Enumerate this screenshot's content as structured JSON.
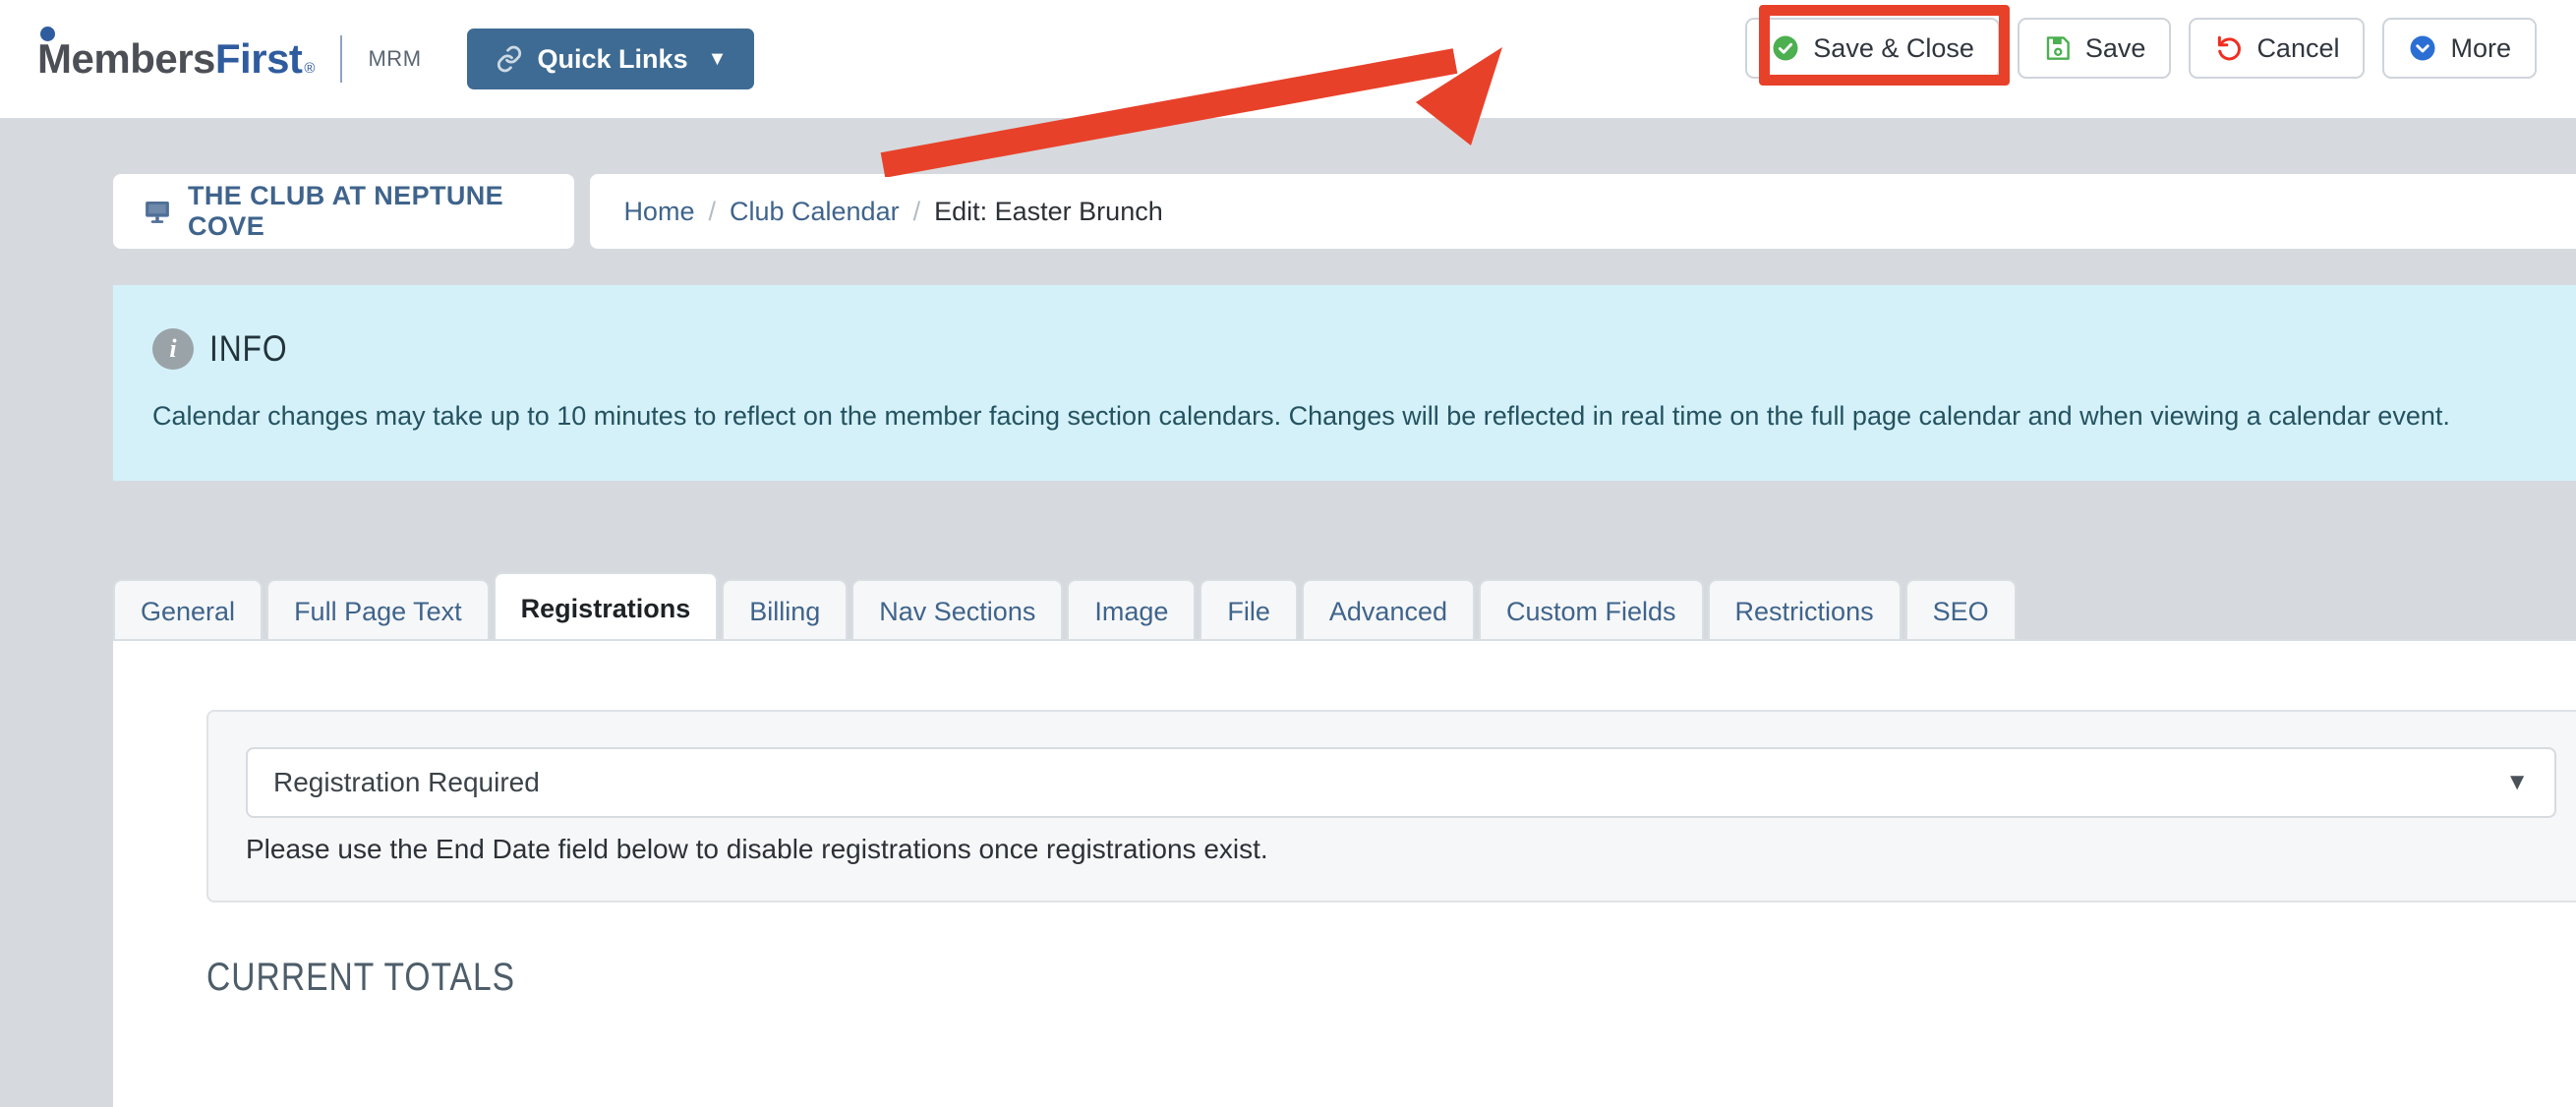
{
  "header": {
    "logo_primary": "Members",
    "logo_secondary": "First",
    "logo_registered": "®",
    "logo_sub": "MRM",
    "quick_links_label": "Quick Links",
    "quick_links_chevron": "⌄"
  },
  "actions": [
    {
      "label": "Save & Close",
      "icon": "check-circle-icon",
      "highlighted": true
    },
    {
      "label": "Save",
      "icon": "floppy-disk-icon",
      "highlighted": false
    },
    {
      "label": "Cancel",
      "icon": "undo-arrow-icon",
      "highlighted": false
    },
    {
      "label": "More",
      "icon": "chevron-down-circle-icon",
      "highlighted": false
    }
  ],
  "site": {
    "name": "THE CLUB AT NEPTUNE COVE",
    "icon": "monitor-icon"
  },
  "breadcrumb": {
    "items": [
      "Home",
      "Club Calendar"
    ],
    "separator": "/",
    "current": "Edit: Easter Brunch"
  },
  "info": {
    "badge": "i",
    "title": "INFO",
    "body": "Calendar changes may take up to 10 minutes to reflect on the member facing section calendars. Changes will be reflected in real time on the full page calendar and when viewing a calendar event."
  },
  "tabs": [
    {
      "label": "General",
      "active": false
    },
    {
      "label": "Full Page Text",
      "active": false
    },
    {
      "label": "Registrations",
      "active": true
    },
    {
      "label": "Billing",
      "active": false
    },
    {
      "label": "Nav Sections",
      "active": false
    },
    {
      "label": "Image",
      "active": false
    },
    {
      "label": "File",
      "active": false
    },
    {
      "label": "Advanced",
      "active": false
    },
    {
      "label": "Custom Fields",
      "active": false
    },
    {
      "label": "Restrictions",
      "active": false
    },
    {
      "label": "SEO",
      "active": false
    }
  ],
  "registrations": {
    "select_value": "Registration Required",
    "select_chevron": "⌄",
    "help_text": "Please use the End Date field below to disable registrations once registrations exist.",
    "totals_heading": "CURRENT TOTALS"
  },
  "annotation": {
    "type": "arrow-and-box",
    "color": "#e8412a",
    "points_to": "Save & Close"
  },
  "colors": {
    "page_bg": "#d6dade",
    "brand_blue": "#2f5c9e",
    "quick_links_bg": "#3e6b93",
    "info_bg": "#d4f1f9",
    "info_text": "#245260",
    "link_blue": "#3f648c",
    "annotation_red": "#e8412a",
    "success_green": "#4caf50",
    "cancel_red": "#f02e21",
    "more_blue": "#2b6fd4"
  }
}
